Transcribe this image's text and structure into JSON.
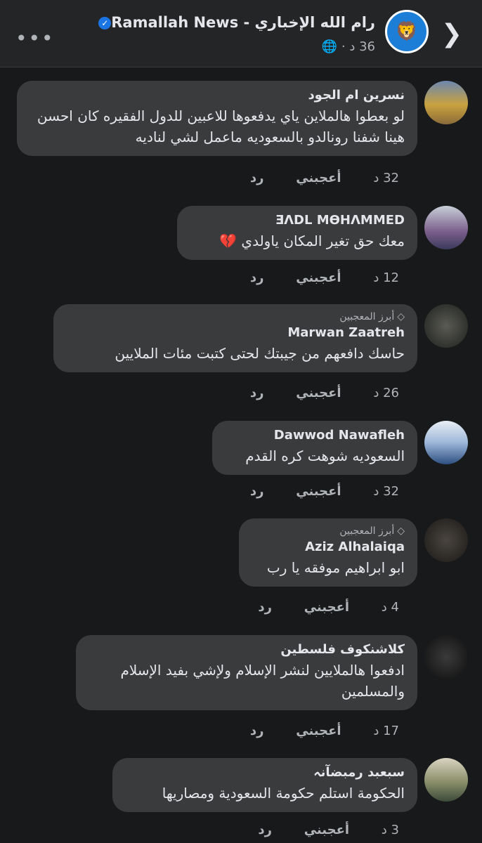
{
  "header": {
    "title": "رام الله  الإخباري - Ramallah News",
    "time": "36 د ·",
    "globe_icon": "globe-icon",
    "menu_icon": "•••",
    "back_icon": "❯"
  },
  "labels": {
    "like": "أعجبني",
    "reply": "رد",
    "top_fan": "أبرز المعجبين"
  },
  "comments": [
    {
      "author": "نسرين ام الجود",
      "text": "لو بعطوا هالملاين ياي يدفعوها للاعبين للدول الفقيره كان احسن هينا شفنا رونالدو بالسعوديه ماعمل لشي لناديه",
      "time": "32 د"
    },
    {
      "author": "ƎΛDL MӨHΛMMED",
      "text": "معك حق تغير المكان ياولدي 💔",
      "time": "12 د"
    },
    {
      "author": "Marwan Zaatreh",
      "text": "حاسك دافعهم من جيبتك لحتى كتبت مئات الملايين",
      "time": "26 د"
    },
    {
      "author": "Dawwod Nawafleh",
      "text": "السعوديه شوهت كره القدم",
      "time": "32 د"
    },
    {
      "author": "Aziz Alhalaiqa",
      "text": "ابو ابراهيم موفقه يا رب",
      "time": "4 د"
    },
    {
      "author": "كلاشنكوف فلسطين",
      "text": "ادفعوا هالملايين لنشر الإسلام ولإشي بفيد الإسلام والمسلمين",
      "time": "17 د"
    },
    {
      "author": "سبعبد رمبضآنہ",
      "text": "الحكومة استلم حكومة السعودية ومصاريها",
      "time": "3 د"
    }
  ]
}
